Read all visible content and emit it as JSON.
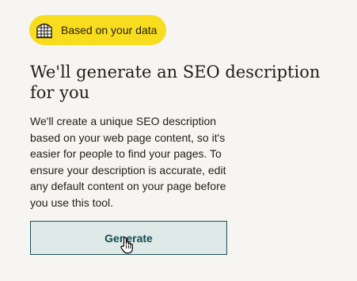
{
  "badge": {
    "label": "Based on your data",
    "icon": "grid-dome-icon",
    "background_color": "#f7dd1e"
  },
  "heading": {
    "text": "We'll generate an SEO description for you"
  },
  "description": {
    "text": "We'll create a unique SEO description based on your web page content, so it's easier for people to find your pages. To ensure your description is accurate, edit any default content on your page before you use this tool."
  },
  "generate_button": {
    "label": "Generate",
    "background_color": "#dfe9e8",
    "border_color": "#1b4f56",
    "text_color": "#124b50"
  },
  "cursor": {
    "icon": "hand-pointer-icon"
  }
}
